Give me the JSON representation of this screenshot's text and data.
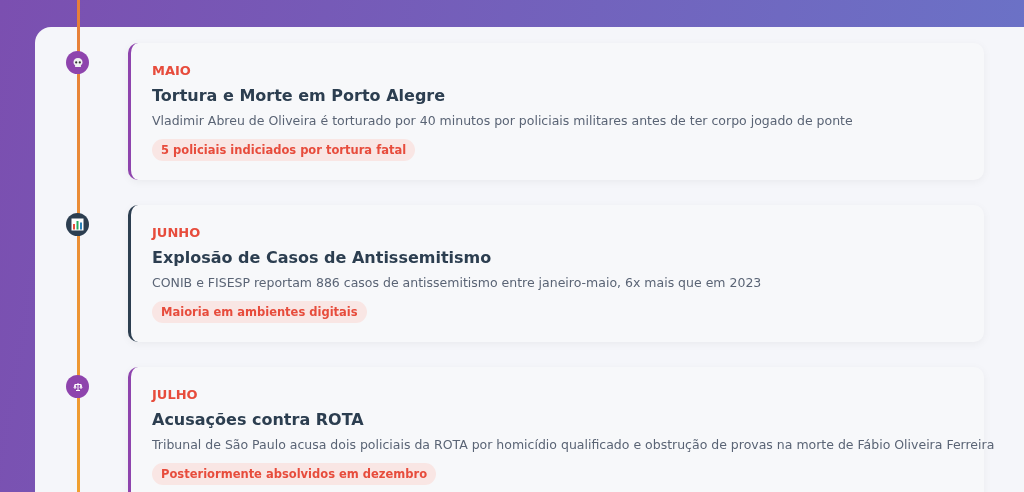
{
  "events": [
    {
      "month": "MAIO",
      "title": "Tortura e Morte em Porto Alegre",
      "description": "Vladimir Abreu de Oliveira é torturado por 40 minutos por policiais militares antes de ter corpo jogado de ponte",
      "tag": "5 policiais indiciados por tortura fatal",
      "kind": "skull",
      "color": "#8e44ad"
    },
    {
      "month": "JUNHO",
      "title": "Explosão de Casos de Antissemitismo",
      "description": "CONIB e FISESP reportam 886 casos de antissemitismo entre janeiro-maio, 6x mais que em 2023",
      "tag": "Maioria em ambientes digitais",
      "kind": "chart",
      "color": "#2c3e50"
    },
    {
      "month": "JULHO",
      "title": "Acusações contra ROTA",
      "description": "Tribunal de São Paulo acusa dois policiais da ROTA por homicídio qualificado e obstrução de provas na morte de Fábio Oliveira Ferreira",
      "tag": "Posteriormente absolvidos em dezembro",
      "kind": "scales",
      "color": "#8e44ad"
    }
  ]
}
